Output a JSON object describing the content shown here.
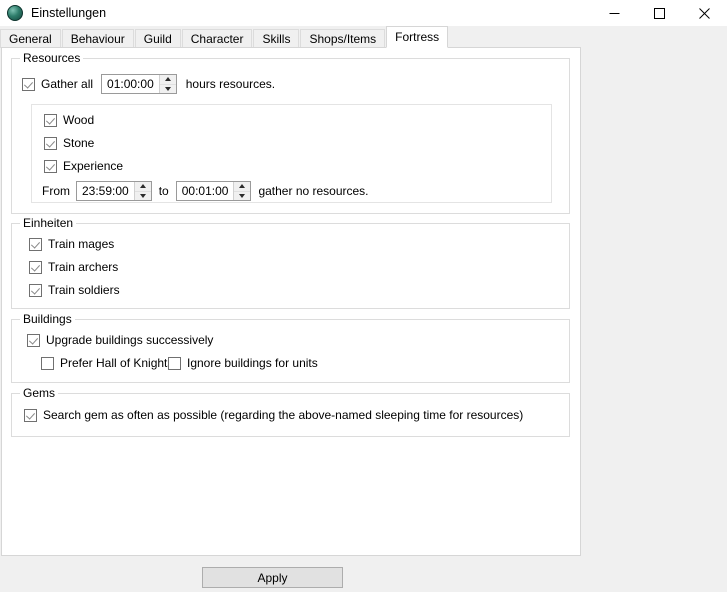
{
  "window": {
    "title": "Einstellungen",
    "icon": "globe-icon",
    "controls": {
      "minimize": "minimize-icon",
      "maximize": "maximize-icon",
      "close": "close-icon"
    }
  },
  "tabs": [
    {
      "label": "General",
      "active": false
    },
    {
      "label": "Behaviour",
      "active": false
    },
    {
      "label": "Guild",
      "active": false
    },
    {
      "label": "Character",
      "active": false
    },
    {
      "label": "Skills",
      "active": false
    },
    {
      "label": "Shops/Items",
      "active": false
    },
    {
      "label": "Fortress",
      "active": true
    }
  ],
  "groups": {
    "resources": {
      "title": "Resources",
      "gather_all": {
        "checkbox_label": "Gather all",
        "checked": true,
        "value": "01:00:00",
        "suffix": "hours resources."
      },
      "inner": {
        "wood": {
          "label": "Wood",
          "checked": true
        },
        "stone": {
          "label": "Stone",
          "checked": true
        },
        "experience": {
          "label": "Experience",
          "checked": true
        },
        "sleep_window": {
          "from_label": "From",
          "from_value": "23:59:00",
          "to_label": "to",
          "to_value": "00:01:00",
          "suffix": "gather no resources."
        }
      }
    },
    "einheiten": {
      "title": "Einheiten",
      "items": [
        {
          "label": "Train mages",
          "checked": true
        },
        {
          "label": "Train archers",
          "checked": true
        },
        {
          "label": "Train soldiers",
          "checked": true
        }
      ]
    },
    "buildings": {
      "title": "Buildings",
      "upgrade": {
        "label": "Upgrade buildings successively",
        "checked": true
      },
      "sub_options": [
        {
          "label": "Prefer Hall of Knights",
          "checked": false
        },
        {
          "label": "Ignore buildings for units",
          "checked": false
        }
      ]
    },
    "gems": {
      "title": "Gems",
      "search": {
        "label": "Search gem as often as possible (regarding the above-named sleeping time for resources)",
        "checked": true
      }
    }
  },
  "footer": {
    "apply_label": "Apply"
  },
  "colors": {
    "window_bg": "#f0f0f0",
    "page_bg": "#ffffff",
    "border": "#dcdcdc",
    "button_bg": "#e1e1e1"
  }
}
